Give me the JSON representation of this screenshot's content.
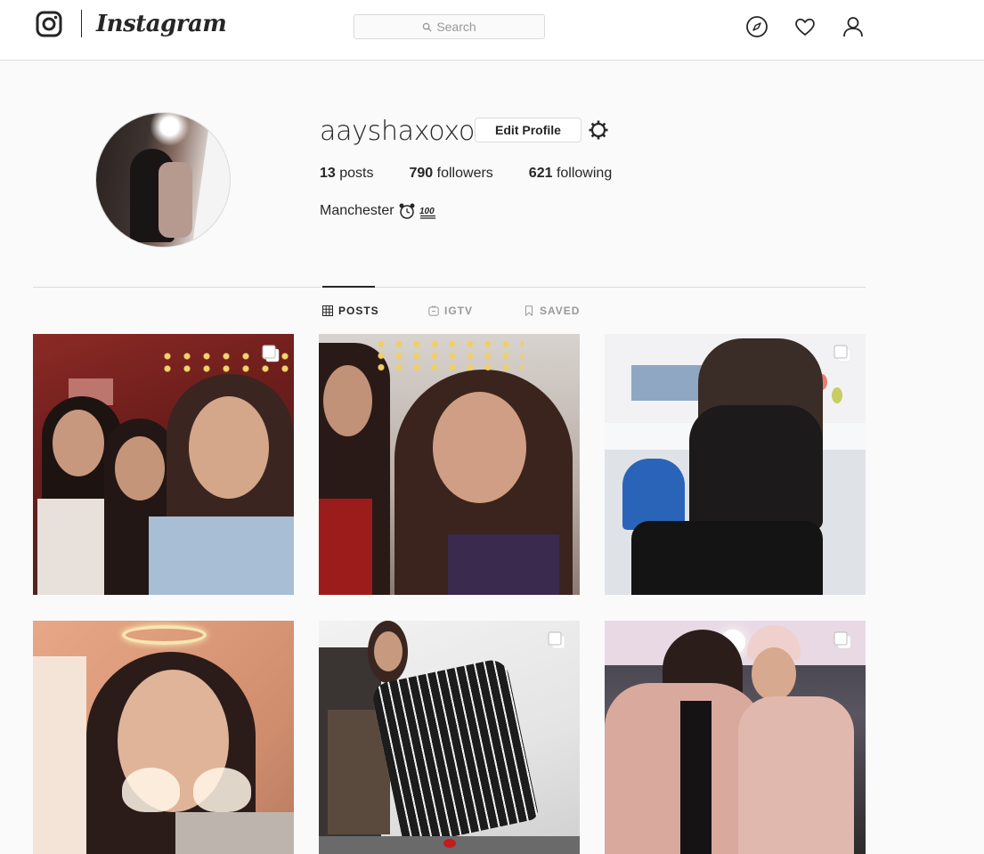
{
  "nav": {
    "wordmark": "Instagram",
    "search_placeholder": "Search",
    "icons": [
      "instagram-logo-icon",
      "compass-icon",
      "heart-icon",
      "user-icon"
    ]
  },
  "profile": {
    "username": "aayshaxoxo",
    "edit_label": "Edit Profile",
    "stats": {
      "posts_count": "13",
      "posts_label": "posts",
      "followers_count": "790",
      "followers_label": "followers",
      "following_count": "621",
      "following_label": "following"
    },
    "bio": "Manchester",
    "bio_emojis": [
      "alarm-clock-emoji",
      "hundred-points-emoji"
    ]
  },
  "tabs": [
    {
      "label": "POSTS",
      "icon": "grid-icon",
      "active": true
    },
    {
      "label": "IGTV",
      "icon": "igtv-icon",
      "active": false
    },
    {
      "label": "SAVED",
      "icon": "bookmark-icon",
      "active": false
    }
  ],
  "posts": [
    {
      "multi": true
    },
    {
      "multi": false
    },
    {
      "multi": true
    },
    {
      "multi": false
    },
    {
      "multi": true
    },
    {
      "multi": true
    }
  ],
  "colors": {
    "nav_bg": "#ffffff",
    "page_bg": "#fafafa",
    "border": "#dbdbdb",
    "text": "#262626",
    "muted": "#999999"
  }
}
